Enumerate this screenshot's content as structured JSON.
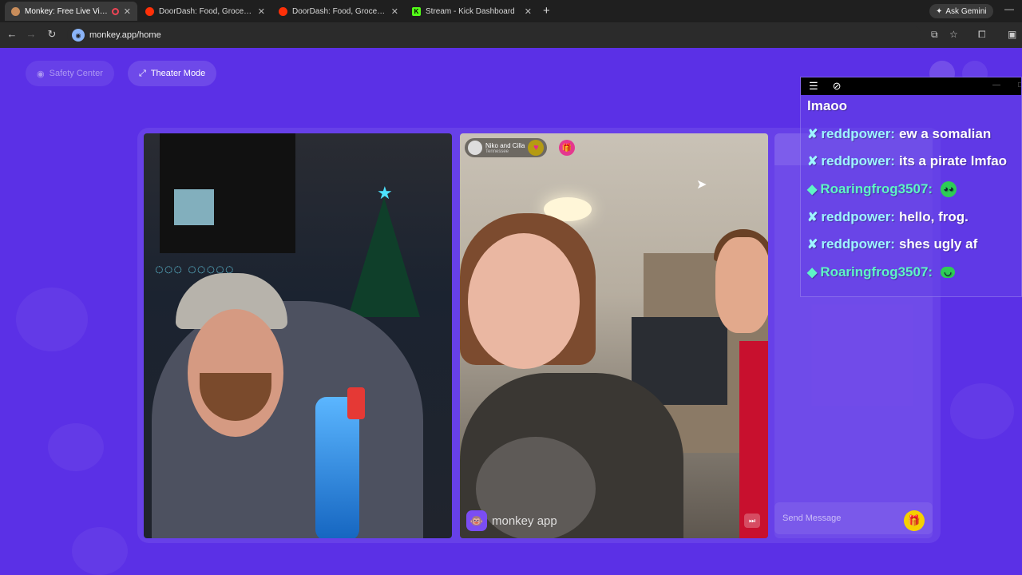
{
  "browser": {
    "tabs": [
      {
        "title": "Monkey: Free Live Video Ch",
        "active": true,
        "icon": "monkey-favicon",
        "recording": true
      },
      {
        "title": "DoorDash: Food, Grocery and F",
        "active": false,
        "icon": "doordash-favicon"
      },
      {
        "title": "DoorDash: Food, Grocery and F",
        "active": false,
        "icon": "doordash-favicon"
      },
      {
        "title": "Stream - Kick Dashboard",
        "active": false,
        "icon": "kick-favicon"
      }
    ],
    "new_tab": "+",
    "ask_gemini": "Ask Gemini",
    "url": "monkey.app/home"
  },
  "page": {
    "safety_center": "Safety Center",
    "theater_mode": "Theater Mode",
    "partner": {
      "name": "Niko and Cilla",
      "location": "Tennessee"
    },
    "watermark": "monkey app",
    "send_message_placeholder": "Send Message"
  },
  "overlay_chat": {
    "messages": [
      {
        "user": "",
        "text": "lmaoo"
      },
      {
        "user": "reddpower:",
        "text": "ew a somalian",
        "badge": "sword-badge"
      },
      {
        "user": "reddpower:",
        "text": "its a pirate lmfao",
        "badge": "sword-badge"
      },
      {
        "user": "Roaringfrog3507:",
        "text": "",
        "badge": "diamond-badge",
        "emote": "frog-emote"
      },
      {
        "user": "reddpower:",
        "text": "hello, frog.",
        "badge": "sword-badge"
      },
      {
        "user": "reddpower:",
        "text": "shes ugly af",
        "badge": "sword-badge"
      },
      {
        "user": "Roaringfrog3507:",
        "text": "",
        "badge": "diamond-badge",
        "emote": "smile-emote"
      }
    ]
  },
  "colors": {
    "page_bg": "#5b30e6",
    "user_blue": "#9ef4ff",
    "user_green": "#5ff5c6",
    "gift_yellow": "#f5d000"
  }
}
